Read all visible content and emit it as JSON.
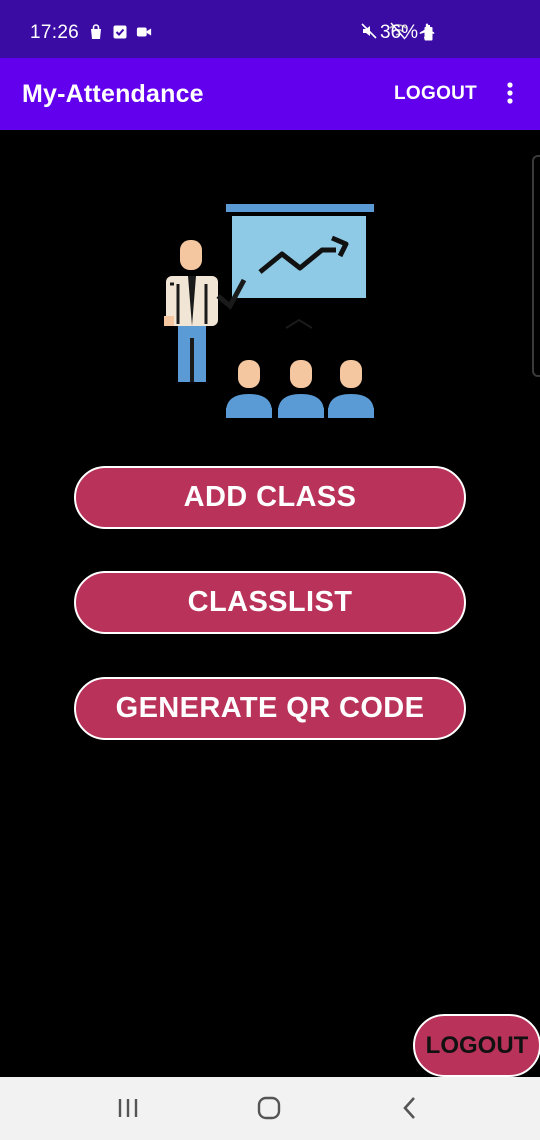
{
  "status_bar": {
    "time": "17:26",
    "battery_percent": "36%",
    "icons_left": [
      "shopping-bag-icon",
      "checkbox-icon",
      "video-icon"
    ],
    "icons_right": [
      "mute-icon",
      "wifi-icon",
      "airplane-icon",
      "battery-icon"
    ]
  },
  "app_bar": {
    "title": "My-Attendance",
    "logout_label": "LOGOUT",
    "overflow_icon": "more-vert-icon"
  },
  "illustration": {
    "icon": "teacher-presentation-icon"
  },
  "menu": {
    "add_class": "ADD CLASS",
    "classlist": "CLASSLIST",
    "generate_qr": "GENERATE QR CODE"
  },
  "fab": {
    "logout_label": "LOGOUT"
  },
  "nav_bar": {
    "icons": [
      "recent-apps-icon",
      "home-icon",
      "back-icon"
    ]
  },
  "colors": {
    "status_bar": "#3a0ca3",
    "app_bar": "#6200ee",
    "button": "#b9325a",
    "background": "#000000",
    "nav_bar": "#f2f2f2"
  }
}
